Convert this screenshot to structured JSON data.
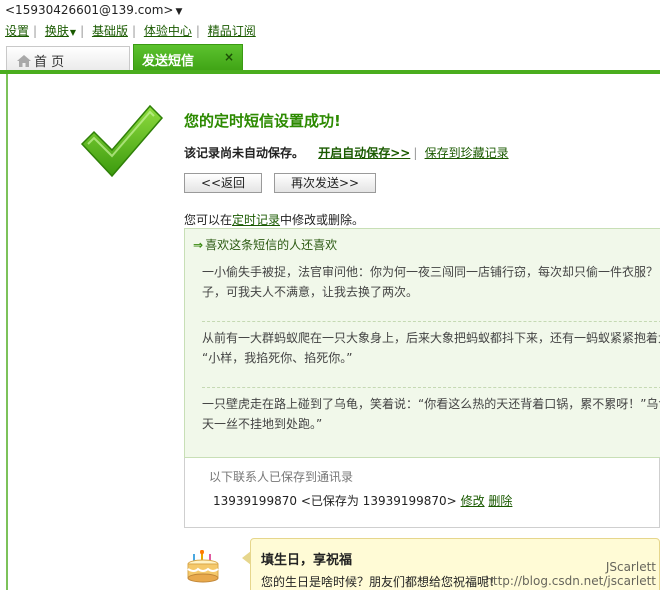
{
  "header": {
    "account": "<15930426601@139.com>",
    "menu": [
      {
        "label": "设置"
      },
      {
        "label": "换肤"
      },
      {
        "label": "基础版"
      },
      {
        "label": "体验中心"
      },
      {
        "label": "精品订阅"
      }
    ]
  },
  "tabs": {
    "home": "首 页",
    "active": "发送短信",
    "close": "×"
  },
  "success": {
    "title": "您的定时短信设置成功!",
    "not_saved": "该记录尚未自动保存。",
    "enable_autosave": "开启自动保存>>",
    "save_to_collection": "保存到珍藏记录",
    "back_button": "<<返回",
    "resend_button": "再次发送>>",
    "modify_prefix": "您可以在",
    "modify_link": "定时记录",
    "modify_suffix": "中修改或删除。"
  },
  "recommend": {
    "heading": "喜欢这条短信的人还喜欢",
    "jokes": [
      {
        "line1": "一小偷失手被捉，法官审问他：你为何一夜三闯同一店铺行窃，每次却只偷一件衣服？",
        "line2": "子，可我夫人不满意，让我去换了两次。"
      },
      {
        "line1": "从前有一大群蚂蚁爬在一只大象身上，后来大象把蚂蚁都抖下来，还有一蚂蚁紧紧抱着大",
        "line2": "“小样，我掐死你、掐死你。”"
      },
      {
        "line1": "一只壁虎走在路上碰到了乌龟，笑着说：“你看这么热的天还背着口锅，累不累呀！”乌龟",
        "line2": "天一丝不挂地到处跑。”"
      }
    ]
  },
  "contacts": {
    "saved_note": "以下联系人已保存到通讯录",
    "number": "13939199870",
    "saved_as": "<已保存为 13939199870>",
    "edit": "修改",
    "delete": "删除"
  },
  "birthday": {
    "title": "填生日，享祝福",
    "text": "您的生日是啥时候？朋友们都想给您祝福呢！"
  },
  "watermark": {
    "author": "JScarlett",
    "url": "http://blog.csdn.net/jscarlett"
  },
  "colors": {
    "brand_green": "#4aad1e",
    "link_green": "#1a5a00",
    "title_green": "#2c8a00"
  }
}
